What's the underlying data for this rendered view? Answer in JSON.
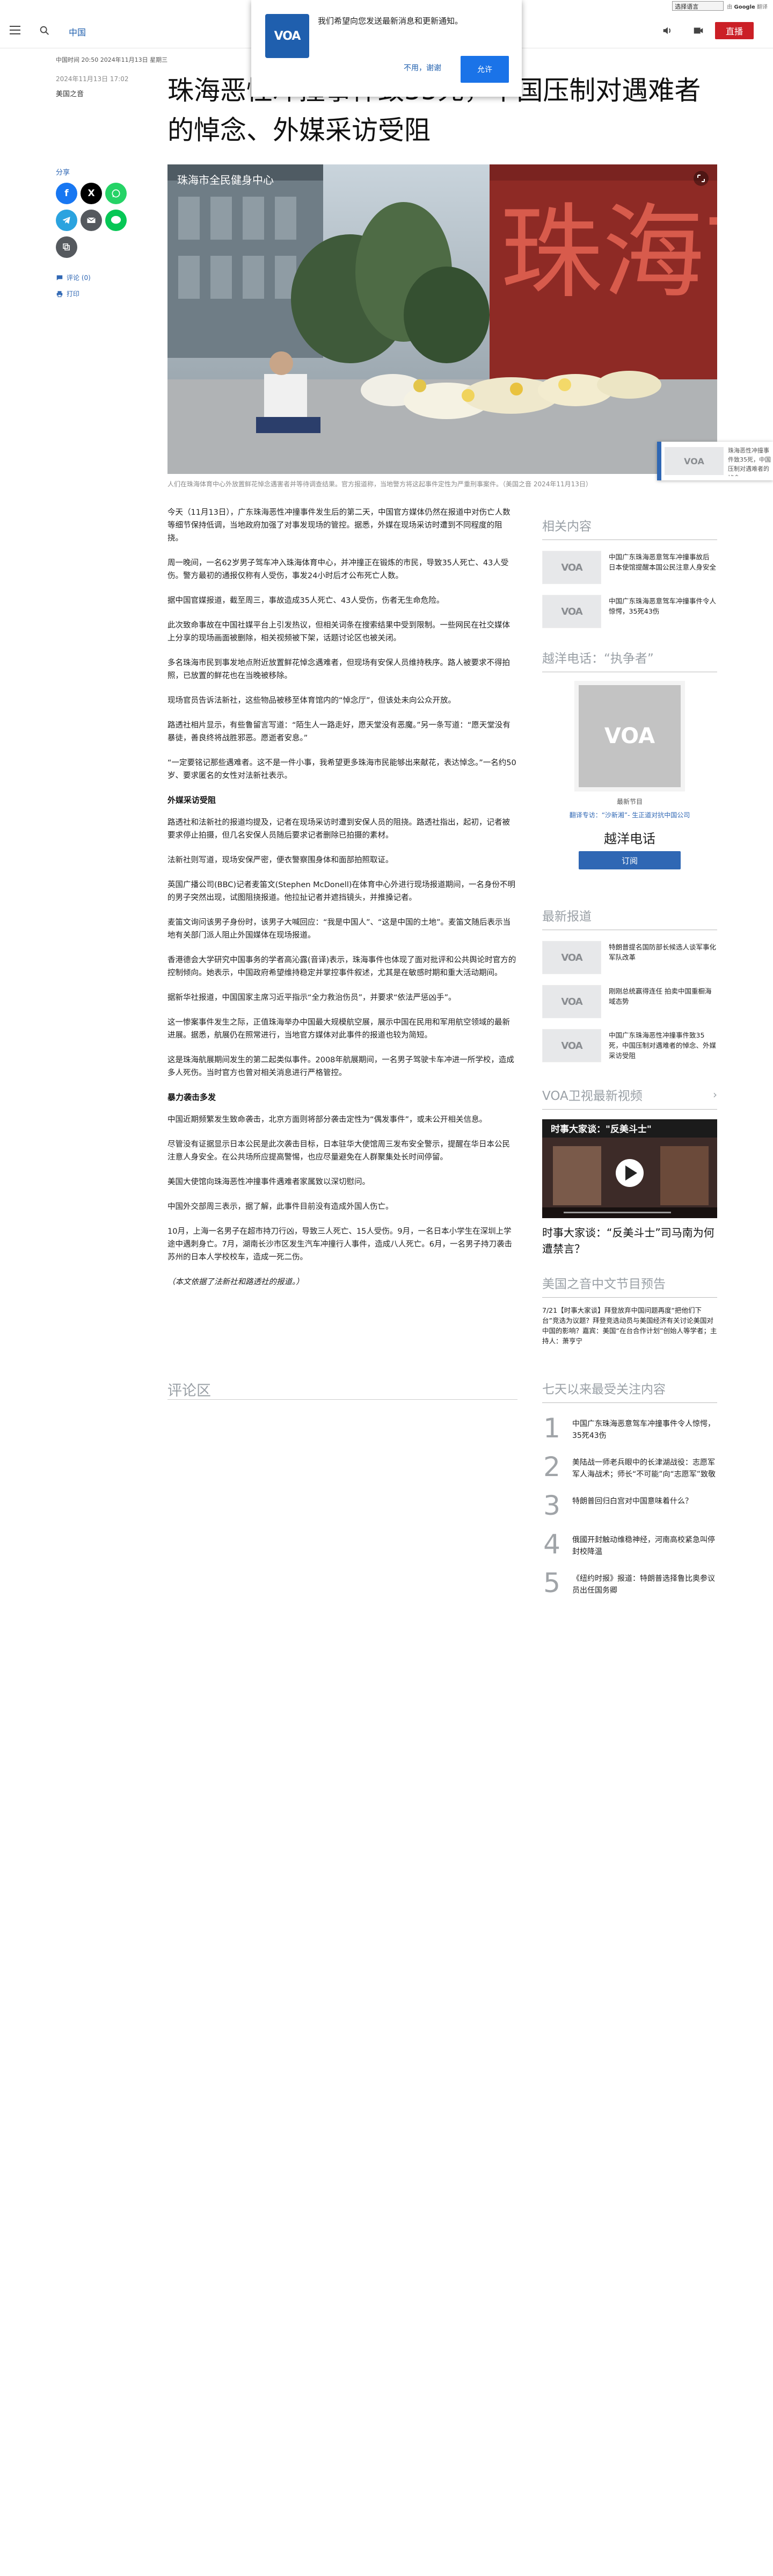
{
  "translate": {
    "select_label": "选择语言",
    "powered": "由",
    "brand": "翻译"
  },
  "header": {
    "section": "中国",
    "live_label": "直播"
  },
  "notification": {
    "message": "我们希望向您发送最新消息和更新通知。",
    "cancel": "不用，谢谢",
    "allow": "允许",
    "logo": "VOA"
  },
  "article": {
    "meta_dates": "中国时间 20:50 2024年11月13日 星期三",
    "publish_date": "2024年11月13日 17:02",
    "author": "美国之音",
    "headline": "珠海恶性冲撞事件致35死，中国压制对遇难者的悼念、外媒采访受阻",
    "caption": "人们在珠海体育中心外放置鲜花悼念遇害者并等待调查结果。官方报道称，当地警方将这起事件定性为严重刑事案件。（美国之音 2024年11月13日）",
    "hero_overlay": "珠海市全民健身中心",
    "sign_text": "珠海市",
    "paragraphs": [
      "今天（11月13日），广东珠海恶性冲撞事件发生后的第二天，中国官方媒体仍然在报道中对伤亡人数等细节保持低调，当地政府加强了对事发现场的管控。据悉，外媒在现场采访时遭到不同程度的阻挠。",
      "周一晚间，一名62岁男子驾车冲入珠海体育中心，并冲撞正在锻炼的市民，导致35人死亡、43人受伤。警方最初的通报仅称有人受伤，事发24小时后才公布死亡人数。",
      "据中国官媒报道，截至周三，事故造成35人死亡、43人受伤，伤者无生命危险。",
      "此次致命事故在中国社媒平台上引发热议，但相关词条在搜索结果中受到限制。一些网民在社交媒体上分享的现场画面被删除，相关视频被下架，话题讨论区也被关闭。",
      "多名珠海市民到事发地点附近放置鲜花悼念遇难者，但现场有安保人员维持秩序。路人被要求不得拍照，已放置的鲜花也在当晚被移除。",
      "现场官员告诉法新社，这些物品被移至体育馆内的“悼念厅”，但该处未向公众开放。",
      "路透社相片显示，有些鲁留言写道：“陌生人一路走好，愿天堂没有恶魔。”另一条写道：“愿天堂没有暴徒，善良终将战胜邪恶。愿逝者安息。”",
      "“一定要铭记那些遇难者。这不是一件小事，我希望更多珠海市民能够出来献花，表达悼念。”一名约50岁、要求匿名的女性对法新社表示。",
      "路透社和法新社的报道均提及，记者在现场采访时遭到安保人员的阻挠。路透社指出，起初，记者被要求停止拍摄，但几名安保人员随后要求记者删除已拍摄的素材。",
      "法新社则写道，现场安保严密，便衣警察围身体和面部拍照取证。",
      "英国广播公司(BBC)记者麦笛文(Stephen McDonell)在体育中心外进行现场报道期间，一名身份不明的男子突然出现，试图阻挠报道。他拉扯记者并遮挡镜头，并推搡记者。",
      "麦笛文询问该男子身份时，该男子大喊回应：“我是中国人”、“这是中国的土地”。麦笛文随后表示当地有关部门派人阻止外国媒体在现场报道。",
      "香港德会大学研究中国事务的学者高沁露(音译)表示，珠海事件也体现了面对批评和公共舆论时官方的控制倾向。她表示，中国政府希望维持稳定并掌控事件叙述，尤其是在敏感时期和重大活动期间。",
      "据新华社报道，中国国家主席习近平指示“全力救治伤员”，并要求“依法严惩凶手”。",
      "这一惨案事件发生之际，正值珠海举办中国最大规模航空展，展示中国在民用和军用航空领域的最新进展。据悉，航展仍在照常进行，当地官方媒体对此事件的报道也较为简短。",
      "这是珠海航展期间发生的第二起类似事件。2008年航展期间，一名男子驾驶卡车冲进一所学校，造成多人死伤。当时官方也曾对相关消息进行严格管控。"
    ],
    "subhead": "外媒采访受阻",
    "subhead2": "暴力袭击多发",
    "paragraphs2": [
      "中国近期频繁发生致命袭击，北京方面则将部分袭击定性为“偶发事件”，或未公开相关信息。",
      "尽管没有证据显示日本公民是此次袭击目标，日本驻华大使馆周三发布安全警示，提醒在华日本公民注意人身安全。在公共场所应提高警惕，也应尽量避免在人群聚集处长时间停留。",
      "美国大使馆向珠海恶性冲撞事件遇难者家属致以深切慰问。",
      "中国外交部周三表示，据了解，此事件目前没有造成外国人伤亡。",
      "10月，上海一名男子在超市持刀行凶，导致三人死亡、15人受伤。9月，一名日本小学生在深圳上学途中遇刺身亡。7月，湖南长沙市区发生汽车冲撞行人事件，造成八人死亡。6月，一名男子持刀袭击苏州的日本人学校校车，造成一死二伤。",
      "（本文依据了法新社和路透社的报道。）"
    ],
    "comments_title": "评论区"
  },
  "share": {
    "label": "分享",
    "comments_link": "评论 (0)",
    "print_link": "打印"
  },
  "sidebar": {
    "related_title": "相关内容",
    "related": [
      {
        "title": "中国广东珠海恶意驾车冲撞事故后 日本使馆提醒本国公民注意人身安全"
      },
      {
        "title": "中国广东珠海恶意驾车冲撞事件令人惊愕，35死43伤"
      }
    ],
    "podcast_title": "越洋电话：“执争者”",
    "podcast_caption": "最新节目",
    "podcast_sub": "翻译专访：“沙新湘”- 生正道对抗中国公司",
    "podcast_name": "越洋电话",
    "podcast_button": "订阅",
    "latest_title": "最新报道",
    "latest": [
      {
        "title": "特朗普提名国防部长候选人谈军事化军队改革"
      },
      {
        "title": "刚刚总统赢得连任 拍卖中国重橱海域态势"
      },
      {
        "title": "中国广东珠海恶性冲撞事件致35死，中国压制对遇难者的悼念、外媒采访受阻"
      }
    ],
    "video_title": "VOA卫视最新视频",
    "video_banner": "时事大家谈：\"反美斗士\"",
    "video_caption": "时事大家谈：“反美斗士”司马南为何遭禁言？",
    "preview_title": "美国之音中文节目预告",
    "preview_text": "7/21【时事大家谈】拜登放弃中国问题再度“把他们下台”竞选为议题？拜登竞选动员与美国经济有关讨论美国对中国的影响？嘉宾：美国“在台合作计划”创始人等学者；主持人：萧亨宁",
    "popular_title": "七天以来最受关注内容",
    "popular": [
      {
        "rank": "1",
        "title": "中国广东珠海恶意驾车冲撞事件令人惊愕，35死43伤"
      },
      {
        "rank": "2",
        "title": "美陆战一师老兵眼中的长津湖战役：志愿军军人海战术；师长“不可能”向“志愿军”致敬"
      },
      {
        "rank": "3",
        "title": "特朗普回归白宫对中国意味着什么？"
      },
      {
        "rank": "4",
        "title": "俄國开封触动维稳神经，河南高校紧急叫停封校降温"
      },
      {
        "rank": "5",
        "title": "《纽约时报》报道：特朗普选择鲁比奥参议员出任国务卿"
      }
    ]
  },
  "sticky": {
    "text": "珠海恶性冲撞事件致35死，中国压制对遇难者的悼念"
  },
  "colors": {
    "brand_blue": "#1f5fae",
    "live_red": "#cb1f26",
    "link_blue": "#2f67b4"
  }
}
